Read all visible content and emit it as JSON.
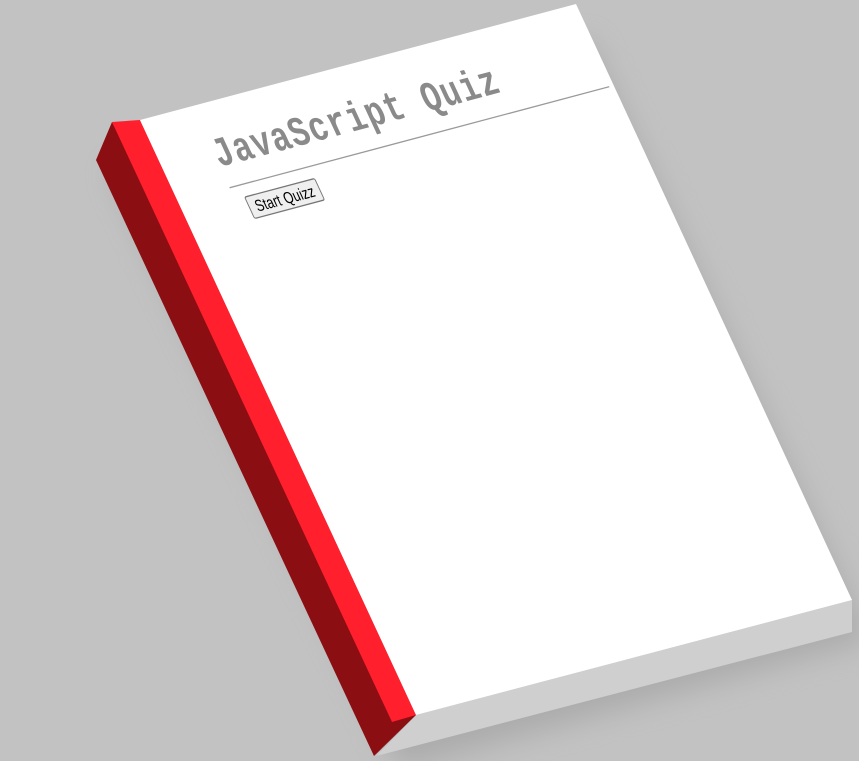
{
  "quiz": {
    "title": "JavaScript Quiz",
    "start_button_label": "Start Quizz"
  },
  "colors": {
    "background": "#c2c2c2",
    "page": "#ffffff",
    "spine_front": "#ff1f2d",
    "spine_side": "#8a0e12",
    "page_edge": "#cfcfcf",
    "title_text": "#8a8a8a"
  }
}
